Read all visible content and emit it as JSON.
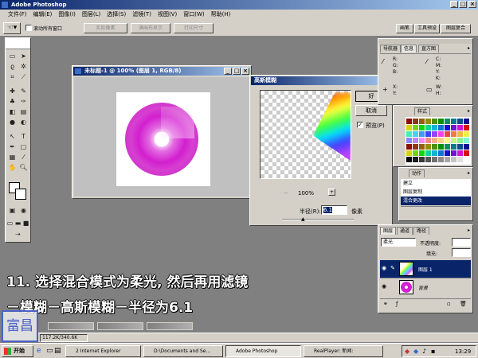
{
  "app_title": "Adobe Photoshop",
  "menu": [
    "文件(F)",
    "编辑(E)",
    "图像(I)",
    "图层(L)",
    "选择(S)",
    "滤镜(T)",
    "视图(V)",
    "窗口(W)",
    "帮助(H)"
  ],
  "options": {
    "checkbox_label": "滚动所有窗口",
    "buttons": [
      "实际像素",
      "满画布显示",
      "打印尺寸"
    ],
    "panel_tabs": [
      "画笔",
      "工具预设",
      "图层复合"
    ]
  },
  "nav_panel": {
    "tabs": [
      "导航器",
      "信息",
      "直方图"
    ],
    "rgb": [
      "R:",
      "G:",
      "B:"
    ],
    "cmyk": [
      "C:",
      "M:",
      "Y:",
      "K:"
    ],
    "xy": [
      "X:",
      "Y:"
    ],
    "wh": [
      "W:",
      "H:"
    ]
  },
  "swatch_panel": {
    "tab": "样式"
  },
  "history_panel": {
    "tab": "动作",
    "items": [
      "建立",
      "图层复制",
      "混合更改"
    ]
  },
  "layers_panel": {
    "tabs": [
      "图层",
      "通道",
      "路径"
    ],
    "blend_mode": "柔光",
    "opacity_label": "不透明度:",
    "fill_label": "填充:",
    "layers": [
      "图层 1",
      "背景"
    ]
  },
  "doc_window": {
    "title": "未标题-1 @ 100% (图层 1, RGB/8)"
  },
  "dialog": {
    "title": "高斯模糊",
    "ok": "好",
    "cancel": "取消",
    "preview_label": "预览(P)",
    "zoom": "100%",
    "radius_label": "半径(R):",
    "radius_value": "6.1",
    "unit": "像素"
  },
  "caption": {
    "line1": "11. 选择混合模式为柔光, 然后再用滤镜",
    "line2": "－模糊－高斯模糊－半径为6.1"
  },
  "status": {
    "doc_size": "117.2K/340.6K"
  },
  "watermark": "富昌",
  "taskbar": {
    "start": "开始",
    "items": [
      "2 Internet Explorer",
      "D:\\Documents and Se...",
      "Adobe Photoshop",
      "RealPlayer: 新闻:"
    ],
    "clock": "13:29"
  },
  "colors": {
    "title_blue": "#0a246a",
    "selection": "#0a246a",
    "face": "#d4d0c8",
    "disc": "#d21fcf"
  }
}
